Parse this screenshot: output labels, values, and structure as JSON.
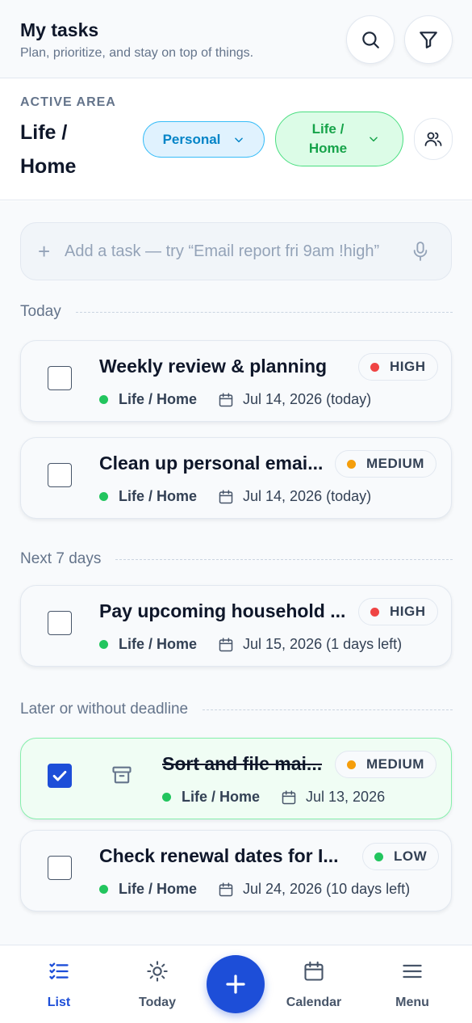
{
  "header": {
    "title": "My tasks",
    "subtitle": "Plan, prioritize, and stay on top of things."
  },
  "area": {
    "label": "ACTIVE AREA",
    "name": "Life / Home",
    "personal_pill": "Personal",
    "life_pill": "Life / Home"
  },
  "add_task": {
    "placeholder": "Add a task — try “Email report fri 9am !high”"
  },
  "sections": {
    "today": "Today",
    "next7": "Next 7 days",
    "later": "Later or without deadline"
  },
  "tasks": [
    {
      "title": "Weekly review & planning",
      "priority": "HIGH",
      "priority_color": "#ef4444",
      "area": "Life / Home",
      "date": "Jul 14, 2026 (today)",
      "done": false
    },
    {
      "title": "Clean up personal emai...",
      "priority": "MEDIUM",
      "priority_color": "#f59e0b",
      "area": "Life / Home",
      "date": "Jul 14, 2026 (today)",
      "done": false
    },
    {
      "title": "Pay upcoming household ...",
      "priority": "HIGH",
      "priority_color": "#ef4444",
      "area": "Life / Home",
      "date": "Jul 15, 2026 (1 days left)",
      "done": false
    },
    {
      "title": "Sort and file mai...",
      "priority": "MEDIUM",
      "priority_color": "#f59e0b",
      "area": "Life / Home",
      "date": "Jul 13, 2026",
      "done": true
    },
    {
      "title": "Check renewal dates for I...",
      "priority": "LOW",
      "priority_color": "#22c55e",
      "area": "Life / Home",
      "date": "Jul 24, 2026 (10 days left)",
      "done": false
    }
  ],
  "nav": {
    "list": "List",
    "today": "Today",
    "calendar": "Calendar",
    "menu": "Menu"
  },
  "colors": {
    "accent": "#1d4ed8",
    "high": "#ef4444",
    "medium": "#f59e0b",
    "low": "#22c55e",
    "area_dot": "#22c55e"
  }
}
